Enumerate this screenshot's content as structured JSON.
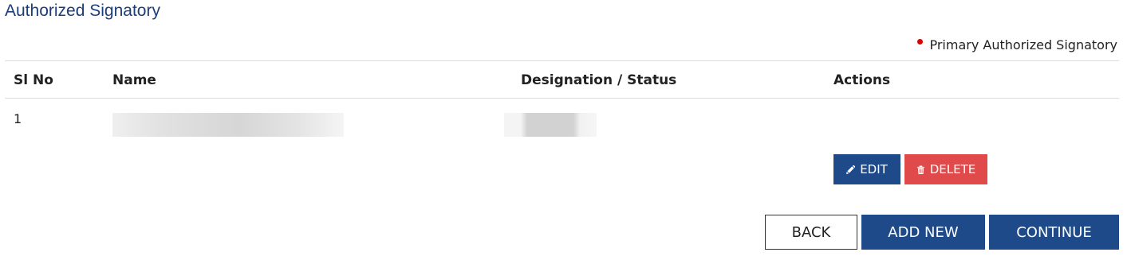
{
  "page": {
    "title": "Authorized Signatory"
  },
  "legend": {
    "label": "Primary Authorized Signatory",
    "dot_color": "#e00000"
  },
  "table": {
    "columns": [
      "Sl No",
      "Name",
      "Designation / Status",
      "Actions"
    ],
    "rows": [
      {
        "sl_no": "1",
        "name": "",
        "designation_status": "",
        "actions": {
          "edit_label": "EDIT",
          "delete_label": "DELETE"
        }
      }
    ]
  },
  "footer": {
    "back_label": "BACK",
    "add_new_label": "ADD NEW",
    "continue_label": "CONTINUE"
  },
  "colors": {
    "primary": "#1f4a8a",
    "danger": "#e04a4a",
    "title": "#1b3d7a"
  },
  "icons": {
    "edit": "pencil-icon",
    "delete": "trash-icon"
  }
}
